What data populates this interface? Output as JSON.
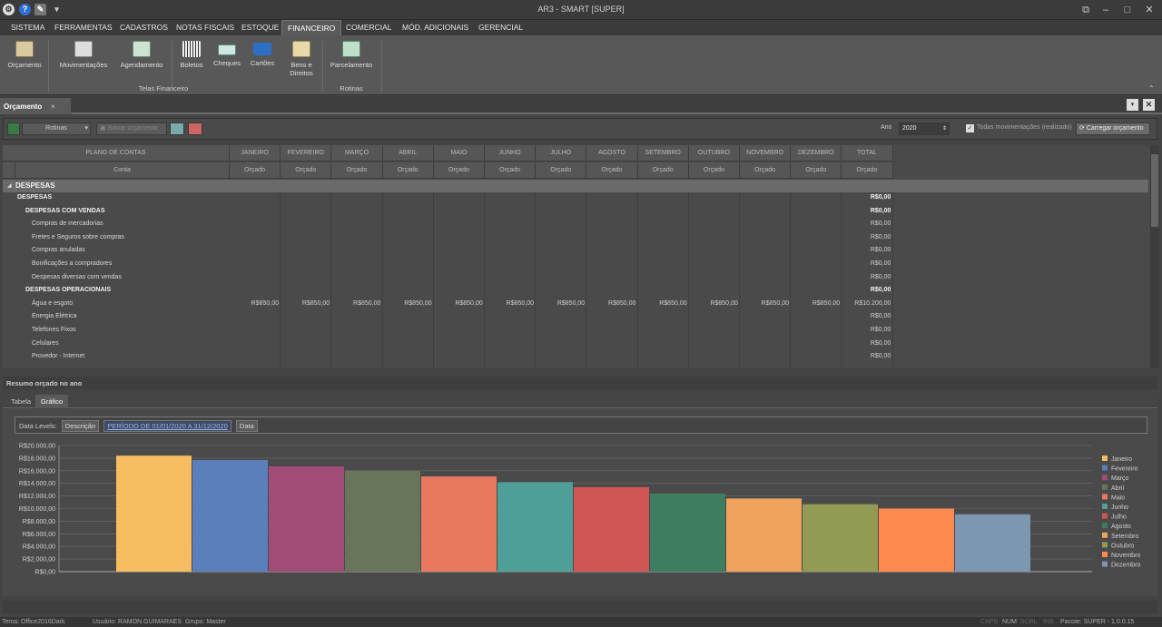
{
  "window": {
    "title": "AR3 - SMART [SUPER]"
  },
  "menu": [
    "SISTEMA",
    "FERRAMENTAS",
    "CADASTROS",
    "NOTAS FISCAIS",
    "ESTOQUE",
    "FINANCEIRO",
    "COMERCIAL",
    "MÓD. ADICIONAIS",
    "GERENCIAL"
  ],
  "ribbon": {
    "buttons": [
      "Orçamento",
      "Movimentações",
      "Agendamento",
      "Boletos",
      "Cheques",
      "Cartões",
      "Bens e Direitos",
      "Parcelamento"
    ],
    "groups": [
      "Telas Financeiro",
      "Rotinas"
    ]
  },
  "doc_tab": {
    "label": "Orçamento"
  },
  "toolbar": {
    "rotinas": "Rotinas",
    "salvar": "Salvar orçamento",
    "ano_label": "Ano",
    "ano_value": "2020",
    "todas_mov": "Todas movimentações (realizado)",
    "carregar": "Carregar orçamento"
  },
  "grid": {
    "header_main": "PLANO DE CONTAS",
    "header_sub": "Conta",
    "months": [
      "JANEIRO",
      "FEVEREIRO",
      "MARÇO",
      "ABRIL",
      "MAIO",
      "JUNHO",
      "JULHO",
      "AGOSTO",
      "SETEMBRO",
      "OUTUBRO",
      "NOVEMBRO",
      "DEZEMBRO",
      "TOTAL"
    ],
    "sub_label": "Orçado",
    "group_header": "DESPESAS",
    "rows": [
      {
        "label": "DESPESAS",
        "level": 0,
        "bold": true,
        "total": "R$0,00"
      },
      {
        "label": "DESPESAS COM VENDAS",
        "level": 1,
        "bold": true,
        "total": "R$0,00"
      },
      {
        "label": "Compras de mercadorias",
        "level": 2,
        "bold": false,
        "total": "R$0,00"
      },
      {
        "label": "Fretes e Seguros sobre compras",
        "level": 2,
        "bold": false,
        "total": "R$0,00"
      },
      {
        "label": "Compras anuladas",
        "level": 2,
        "bold": false,
        "total": "R$0,00"
      },
      {
        "label": "Bonificações a compradores",
        "level": 2,
        "bold": false,
        "total": "R$0,00"
      },
      {
        "label": "Despesas diversas com vendas",
        "level": 2,
        "bold": false,
        "total": "R$0,00"
      },
      {
        "label": "DESPESAS OPERACIONAIS",
        "level": 1,
        "bold": true,
        "total": "R$0,00"
      },
      {
        "label": "Água e esgoto",
        "level": 2,
        "bold": false,
        "months": [
          "R$850,00",
          "R$850,00",
          "R$850,00",
          "R$850,00",
          "R$850,00",
          "R$850,00",
          "R$850,00",
          "R$850,00",
          "R$850,00",
          "R$850,00",
          "R$850,00",
          "R$850,00"
        ],
        "total": "R$10.200,00"
      },
      {
        "label": "Energia Elétrica",
        "level": 2,
        "bold": false,
        "total": "R$0,00"
      },
      {
        "label": "Telefones Fixos",
        "level": 2,
        "bold": false,
        "total": "R$0,00"
      },
      {
        "label": "Celulares",
        "level": 2,
        "bold": false,
        "total": "R$0,00"
      },
      {
        "label": "Provedor - Internet",
        "level": 2,
        "bold": false,
        "total": "R$0,00"
      }
    ]
  },
  "resumo": {
    "title": "Resumo orçado no ano",
    "tabs": [
      "Tabela",
      "Gráfico"
    ]
  },
  "datalevels": {
    "label": "Data Levels:",
    "descricao": "Descrição",
    "link": "PERÍODO DE 01/01/2020 A 31/12/2020",
    "data": "Data"
  },
  "chart_data": {
    "type": "bar",
    "categories": [
      "Janeiro",
      "Fevereiro",
      "Março",
      "Abril",
      "Maio",
      "Junho",
      "Julho",
      "Agosto",
      "Setembro",
      "Outubro",
      "Novembro",
      "Dezembro"
    ],
    "values": [
      18400,
      17700,
      16700,
      16000,
      15100,
      14200,
      13400,
      12400,
      11600,
      10700,
      10000,
      9100
    ],
    "colors": [
      "#f6bd60",
      "#5b7fba",
      "#a04e78",
      "#68755a",
      "#e8795f",
      "#4e9f98",
      "#cf5655",
      "#3f7d60",
      "#f0a35c",
      "#939a54",
      "#ff8a50",
      "#7b97b2"
    ],
    "yticks": [
      "R$0,00",
      "R$2.000,00",
      "R$4.000,00",
      "R$6.000,00",
      "R$8.000,00",
      "R$10.000,00",
      "R$12.000,00",
      "R$14.000,00",
      "R$16.000,00",
      "R$18.000,00",
      "R$20.000,00"
    ],
    "ylim": [
      0,
      20000
    ],
    "legend_position": "right"
  },
  "status": {
    "tema": "Tema: Office2016Dark",
    "usuario": "Usuário: RAMON.GUIMARAES",
    "grupo": "Grupo: Master",
    "caps": "CAPS",
    "num": "NUM",
    "scrl": "SCRL",
    "ins": "INS",
    "pacote": "Pacote: SUPER - 1.0.0.15"
  }
}
